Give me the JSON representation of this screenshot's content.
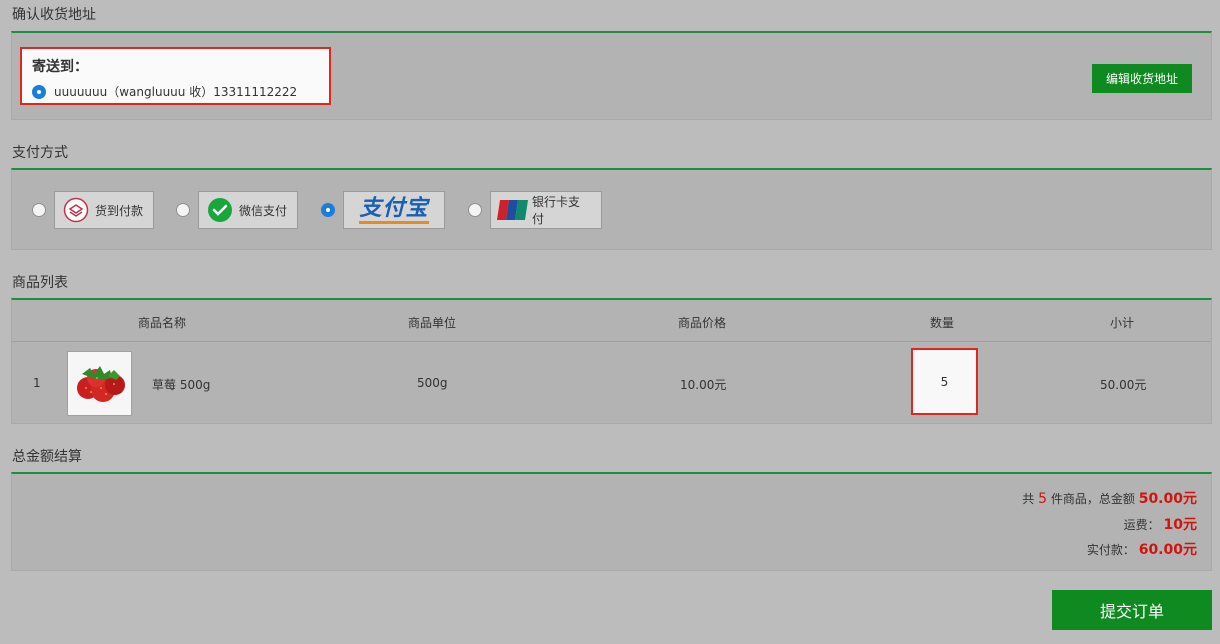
{
  "address": {
    "section_title": "确认收货地址",
    "ship_to_label": "寄送到：",
    "selected_address": "uuuuuuu（wangluuuu 收）13311112222",
    "edit_button": "编辑收货地址"
  },
  "payment": {
    "section_title": "支付方式",
    "options": [
      {
        "label": "货到付款",
        "icon": "cash-on-delivery-icon",
        "selected": false
      },
      {
        "label": "微信支付",
        "icon": "wechat-pay-icon",
        "selected": false
      },
      {
        "label": "支付宝",
        "icon": "alipay-logo",
        "selected": true
      },
      {
        "label": "银行卡支付",
        "icon": "unionpay-icon",
        "selected": false
      }
    ]
  },
  "goods": {
    "section_title": "商品列表",
    "headers": [
      "商品名称",
      "商品单位",
      "商品价格",
      "数量",
      "小计"
    ],
    "rows": [
      {
        "index": "1",
        "image": "strawberry-image",
        "name": "草莓 500g",
        "unit": "500g",
        "price": "10.00元",
        "quantity": "5",
        "subtotal": "50.00元"
      }
    ]
  },
  "totals": {
    "section_title": "总金额结算",
    "count_prefix": "共",
    "count": "5",
    "count_suffix": "件商品，总金额",
    "total": "50.00元",
    "shipping_label": "运费：",
    "shipping": "10元",
    "paid_label": "实付款：",
    "paid": "60.00元"
  },
  "submit_button": "提交订单",
  "colors": {
    "accent_green": "#0f8a21",
    "highlight_red": "#e0271f",
    "price_red": "#d0140f",
    "radio_blue": "#1a7de0"
  }
}
